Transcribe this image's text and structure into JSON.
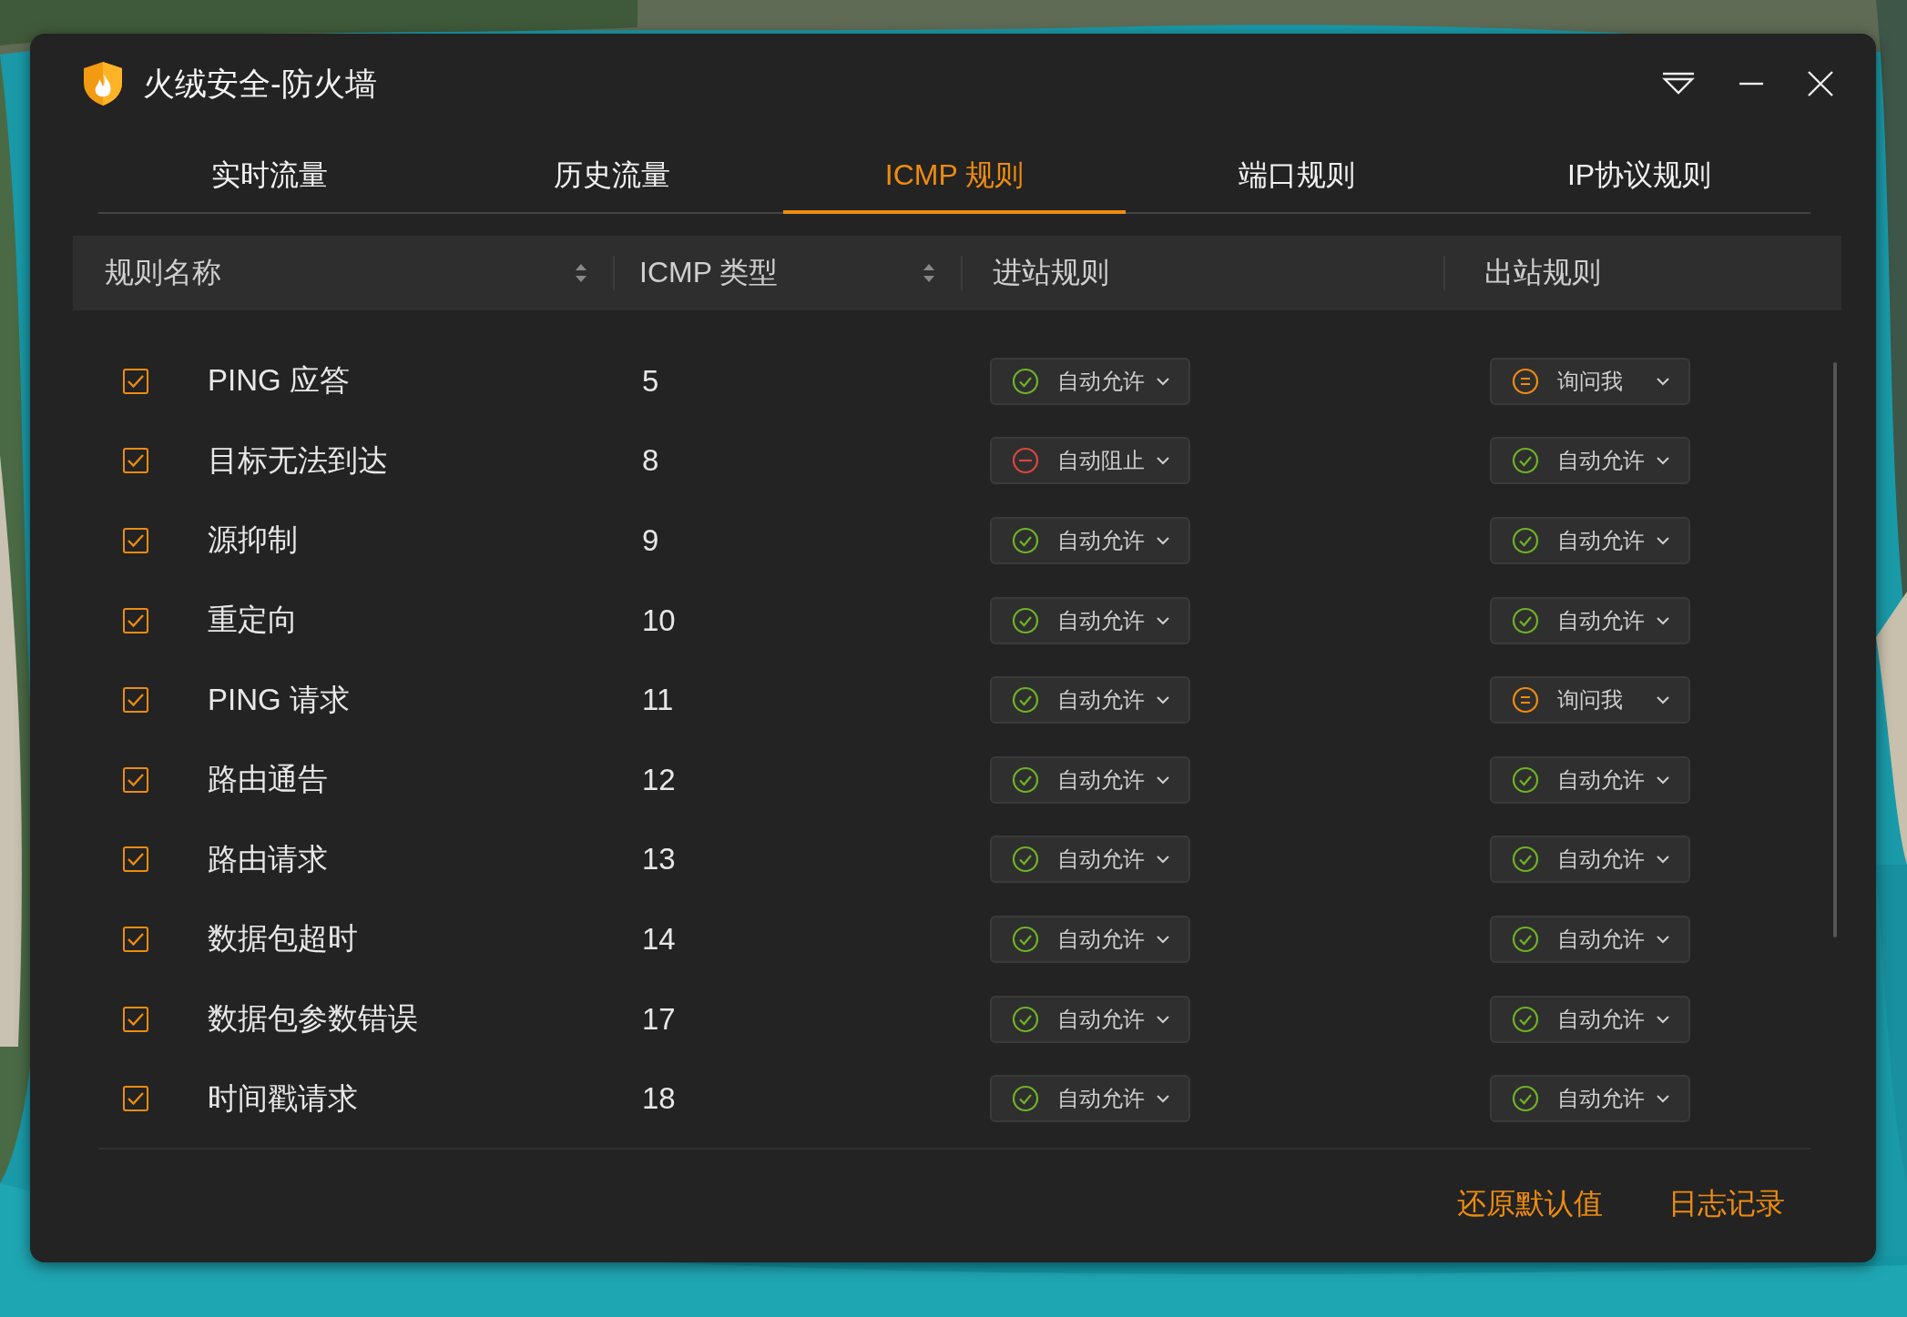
{
  "window": {
    "title": "火绒安全-防火墙"
  },
  "tabs": [
    {
      "label": "实时流量",
      "selected": false
    },
    {
      "label": "历史流量",
      "selected": false
    },
    {
      "label": "ICMP 规则",
      "selected": true
    },
    {
      "label": "端口规则",
      "selected": false
    },
    {
      "label": "IP协议规则",
      "selected": false
    }
  ],
  "table": {
    "columns": [
      {
        "label": "规则名称",
        "sortable": true
      },
      {
        "label": "ICMP 类型",
        "sortable": true
      },
      {
        "label": "进站规则",
        "sortable": false
      },
      {
        "label": "出站规则",
        "sortable": false
      }
    ],
    "rows": [
      {
        "checked": true,
        "name": "PING 应答",
        "type": "5",
        "inbound": {
          "kind": "allow",
          "label": "自动允许"
        },
        "outbound": {
          "kind": "ask",
          "label": "询问我"
        }
      },
      {
        "checked": true,
        "name": "目标无法到达",
        "type": "8",
        "inbound": {
          "kind": "block",
          "label": "自动阻止"
        },
        "outbound": {
          "kind": "allow",
          "label": "自动允许"
        }
      },
      {
        "checked": true,
        "name": "源抑制",
        "type": "9",
        "inbound": {
          "kind": "allow",
          "label": "自动允许"
        },
        "outbound": {
          "kind": "allow",
          "label": "自动允许"
        }
      },
      {
        "checked": true,
        "name": "重定向",
        "type": "10",
        "inbound": {
          "kind": "allow",
          "label": "自动允许"
        },
        "outbound": {
          "kind": "allow",
          "label": "自动允许"
        }
      },
      {
        "checked": true,
        "name": "PING 请求",
        "type": "11",
        "inbound": {
          "kind": "allow",
          "label": "自动允许"
        },
        "outbound": {
          "kind": "ask",
          "label": "询问我"
        }
      },
      {
        "checked": true,
        "name": "路由通告",
        "type": "12",
        "inbound": {
          "kind": "allow",
          "label": "自动允许"
        },
        "outbound": {
          "kind": "allow",
          "label": "自动允许"
        }
      },
      {
        "checked": true,
        "name": "路由请求",
        "type": "13",
        "inbound": {
          "kind": "allow",
          "label": "自动允许"
        },
        "outbound": {
          "kind": "allow",
          "label": "自动允许"
        }
      },
      {
        "checked": true,
        "name": "数据包超时",
        "type": "14",
        "inbound": {
          "kind": "allow",
          "label": "自动允许"
        },
        "outbound": {
          "kind": "allow",
          "label": "自动允许"
        }
      },
      {
        "checked": true,
        "name": "数据包参数错误",
        "type": "17",
        "inbound": {
          "kind": "allow",
          "label": "自动允许"
        },
        "outbound": {
          "kind": "allow",
          "label": "自动允许"
        }
      },
      {
        "checked": true,
        "name": "时间戳请求",
        "type": "18",
        "inbound": {
          "kind": "allow",
          "label": "自动允许"
        },
        "outbound": {
          "kind": "allow",
          "label": "自动允许"
        }
      }
    ]
  },
  "footer": {
    "links": [
      "还原默认值",
      "日志记录"
    ]
  }
}
